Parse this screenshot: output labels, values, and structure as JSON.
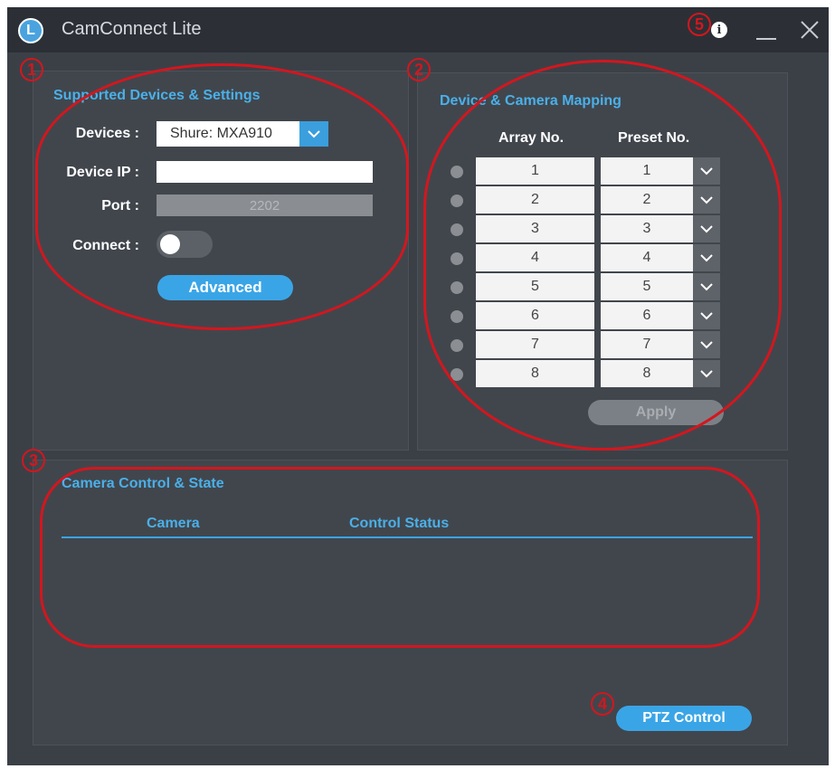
{
  "window": {
    "title": "CamConnect Lite",
    "logo_letter": "L"
  },
  "devices_panel": {
    "title": "Supported Devices & Settings",
    "devices_label": "Devices :",
    "device_value": "Shure: MXA910",
    "ip_label": "Device IP :",
    "ip_value": "",
    "port_label": "Port :",
    "port_value": "2202",
    "connect_label": "Connect :",
    "connect_on": false,
    "advanced_label": "Advanced"
  },
  "mapping_panel": {
    "title": "Device & Camera Mapping",
    "array_header": "Array No.",
    "preset_header": "Preset No.",
    "rows": [
      {
        "array": "1",
        "preset": "1"
      },
      {
        "array": "2",
        "preset": "2"
      },
      {
        "array": "3",
        "preset": "3"
      },
      {
        "array": "4",
        "preset": "4"
      },
      {
        "array": "5",
        "preset": "5"
      },
      {
        "array": "6",
        "preset": "6"
      },
      {
        "array": "7",
        "preset": "7"
      },
      {
        "array": "8",
        "preset": "8"
      }
    ],
    "apply_label": "Apply"
  },
  "control_panel": {
    "title": "Camera Control & State",
    "camera_header": "Camera",
    "status_header": "Control Status",
    "ptz_label": "PTZ Control"
  },
  "annotations": [
    "1",
    "2",
    "3",
    "4",
    "5"
  ],
  "colors": {
    "background": "#3b4047",
    "titlebar": "#2c3036",
    "accent": "#3aa5e6",
    "annotation": "#d4161e"
  }
}
